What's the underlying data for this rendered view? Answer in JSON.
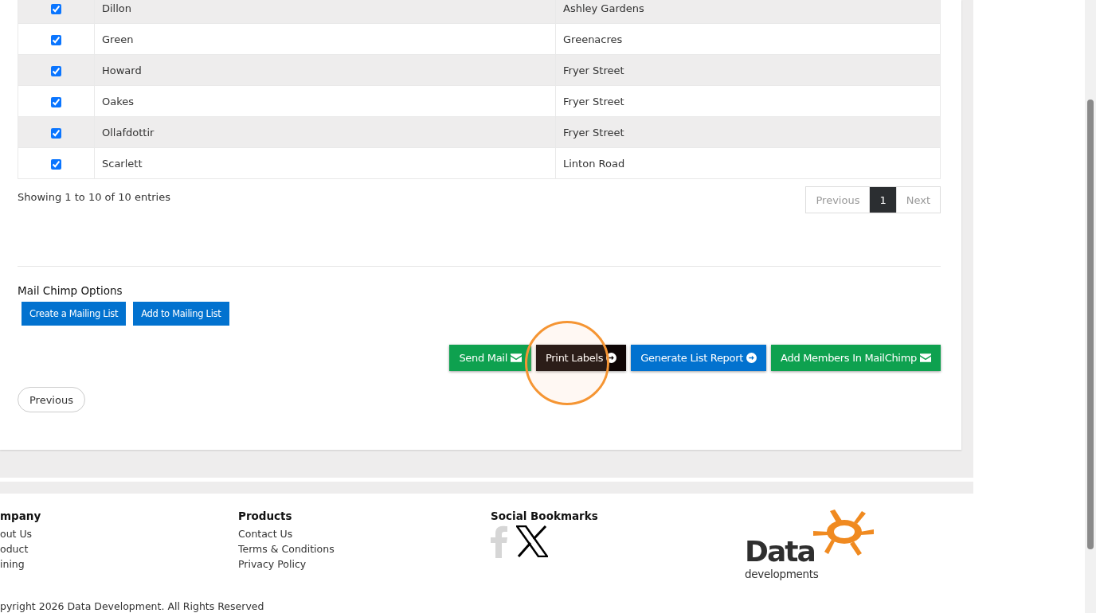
{
  "table": {
    "rows": [
      {
        "checked": true,
        "name": "Dillon",
        "street": "Ashley Gardens"
      },
      {
        "checked": true,
        "name": "Green",
        "street": "Greenacres"
      },
      {
        "checked": true,
        "name": "Howard",
        "street": "Fryer Street"
      },
      {
        "checked": true,
        "name": "Oakes",
        "street": "Fryer Street"
      },
      {
        "checked": true,
        "name": "Ollafdottir",
        "street": "Fryer Street"
      },
      {
        "checked": true,
        "name": "Scarlett",
        "street": "Linton Road"
      }
    ]
  },
  "table_info": "Showing 1 to 10 of 10 entries",
  "pagination": [
    {
      "label": "Previous",
      "selected": false
    },
    {
      "label": "1",
      "selected": true
    },
    {
      "label": "Next",
      "selected": false
    }
  ],
  "mailchimp": {
    "title": "Mail Chimp Options",
    "buttons": [
      "Create a Mailing List",
      "Add to Mailing List"
    ]
  },
  "actions": [
    {
      "label": "Send Mail",
      "kind": "mail"
    },
    {
      "label": "Print Labels",
      "kind": "print"
    },
    {
      "label": "Generate List Report",
      "kind": "report"
    },
    {
      "label": "Add Members In MailChimp",
      "kind": "mail"
    }
  ],
  "previous_button": "Previous",
  "footer": {
    "columns": [
      {
        "title": "mpany",
        "links": [
          "out Us",
          "oduct",
          "ining"
        ]
      },
      {
        "title": "Products",
        "links": [
          "Contact Us",
          "Terms & Conditions",
          "Privacy Policy"
        ]
      }
    ],
    "social_title": "Social Bookmarks",
    "logo": {
      "word": "Data",
      "sub": "developments"
    },
    "copyright": "pyright 2026 Data Development. All Rights Reserved"
  }
}
